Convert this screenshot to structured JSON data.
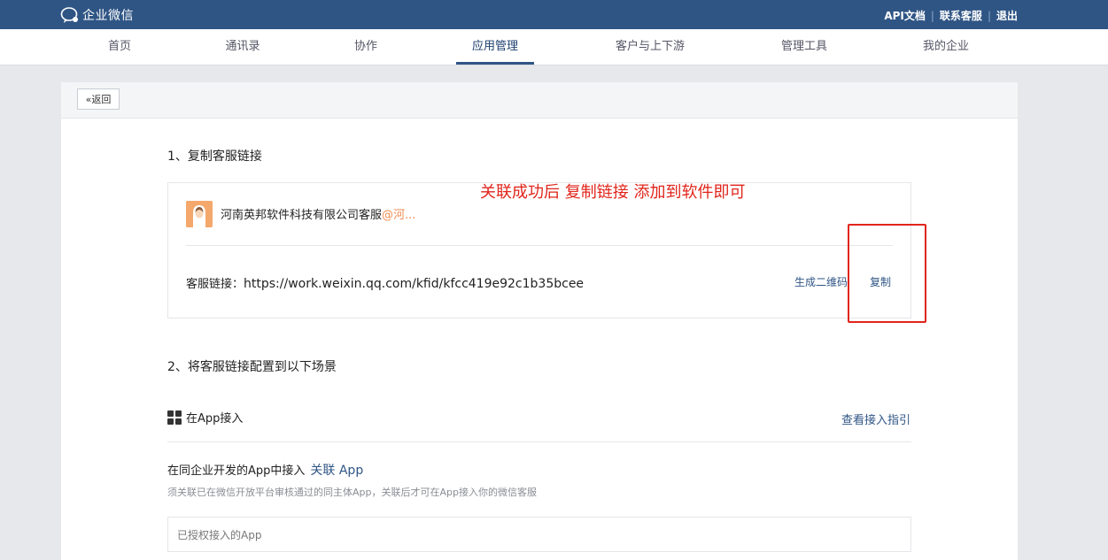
{
  "header": {
    "logo_text": "企业微信",
    "links": [
      "API文档",
      "联系客服",
      "退出"
    ]
  },
  "nav": {
    "items": [
      "首页",
      "通讯录",
      "协作",
      "应用管理",
      "客户与上下游",
      "管理工具",
      "我的企业"
    ],
    "active": "应用管理"
  },
  "card": {
    "back_label": "返回",
    "step1_title": "1、复制客服链接",
    "agent": {
      "name": "河南英邦软件科技有限公司客服",
      "corp_suffix": "@河..."
    },
    "link_label": "客服链接：",
    "link_url": "https://work.weixin.qq.com/kfid/kfcc419e92c1b35bcee",
    "qr_label": "生成二维码",
    "copy_label": "复制",
    "step2_title": "2、将客服链接配置到以下场景",
    "app_section": {
      "title": "在App接入",
      "guide_link": "查看接入指引",
      "sub_title": "在同企业开发的App中接入",
      "associate_link": "关联 App",
      "hint": "须关联已在微信开放平台审核通过的同主体App，关联后才可在App接入你的微信客服",
      "authorized_label": "已授权接入的App"
    }
  },
  "annotation": {
    "text": "关联成功后 复制链接  添加到软件即可",
    "color": "#e1251b"
  },
  "colors": {
    "brand": "#2f5585",
    "link": "#2f5585",
    "corp_tag": "#f08a4b"
  }
}
